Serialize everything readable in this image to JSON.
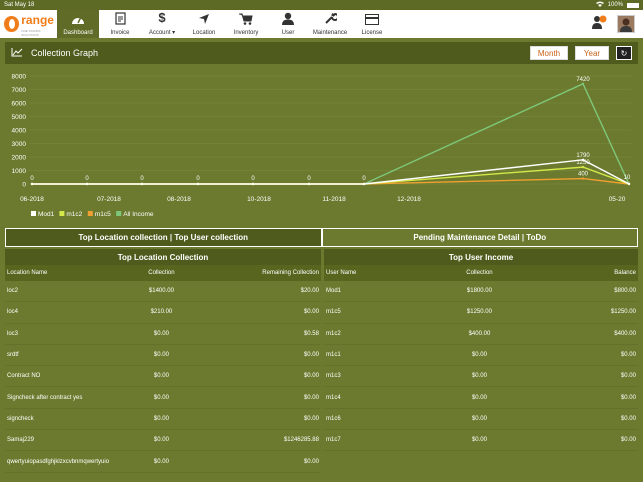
{
  "status": {
    "time_date": "Sat May 18",
    "battery": "100%"
  },
  "app": {
    "logo_text": "range",
    "logo_tag": "ONE STANDS SOLUTIONS"
  },
  "nav": [
    {
      "label": "Dashboard",
      "icon": "dashboard-icon",
      "active": true
    },
    {
      "label": "Invoice",
      "icon": "invoice-icon"
    },
    {
      "label": "Account ▾",
      "icon": "dollar-icon"
    },
    {
      "label": "Location",
      "icon": "location-arrow-icon"
    },
    {
      "label": "Inventory",
      "icon": "cart-icon"
    },
    {
      "label": "User",
      "icon": "user-icon"
    },
    {
      "label": "Maintenance",
      "icon": "wrench-icon"
    },
    {
      "label": "License",
      "icon": "license-card-icon"
    }
  ],
  "chart_header": {
    "title": "Collection Graph",
    "month_label": "Month",
    "year_label": "Year",
    "refresh_symbol": "↻"
  },
  "chart_data": {
    "type": "line",
    "x": [
      "06-2018",
      "07-2018",
      "08-2018",
      "10-2018",
      "11-2018",
      "12-2018",
      "05-20"
    ],
    "ylim": [
      0,
      8000
    ],
    "yticks": [
      0,
      1000,
      2000,
      3000,
      4000,
      5000,
      6000,
      7000,
      8000
    ],
    "point_labels": [
      {
        "x": "06-2018",
        "text": "0"
      },
      {
        "x": "07-2018",
        "text": "0"
      },
      {
        "x": "08-2018",
        "text": "0"
      },
      {
        "x": "10-2018",
        "text": "0"
      },
      {
        "x": "11-2018",
        "text": "0"
      },
      {
        "x": "12-2018",
        "text": "0"
      },
      {
        "x": "12-2018b",
        "text": "0"
      },
      {
        "x": "05-20",
        "text": "10"
      }
    ],
    "series": [
      {
        "name": "Mod1",
        "color": "#ffffff",
        "values": [
          0,
          0,
          0,
          0,
          0,
          0,
          0,
          1790,
          10
        ]
      },
      {
        "name": "m1c2",
        "color": "#d4e84a",
        "values": [
          0,
          0,
          0,
          0,
          0,
          0,
          0,
          1250,
          0
        ]
      },
      {
        "name": "m1c5",
        "color": "#f0a030",
        "values": [
          0,
          0,
          0,
          0,
          0,
          0,
          0,
          400,
          0
        ]
      },
      {
        "name": "All Income",
        "color": "#7fc77a",
        "values": [
          0,
          0,
          0,
          0,
          0,
          0,
          0,
          7420,
          0
        ]
      }
    ],
    "peak_labels": [
      "7420",
      "1790",
      "1250",
      "400"
    ],
    "legend_position": "bottom-left"
  },
  "tabs": {
    "left": "Top Location collection | Top User collection",
    "right": "Pending Maintenance Detail | ToDo"
  },
  "location_table": {
    "title": "Top Location Collection",
    "headers": [
      "Location Name",
      "Collection",
      "Remaining Collection"
    ],
    "rows": [
      [
        "loc2",
        "$1400.00",
        "$20.00"
      ],
      [
        "loc4",
        "$210.00",
        "$0.00"
      ],
      [
        "loc3",
        "$0.00",
        "$0.58"
      ],
      [
        "srdtf",
        "$0.00",
        "$0.00"
      ],
      [
        "Contract NO",
        "$0.00",
        "$0.00"
      ],
      [
        "Signcheck after contract yes",
        "$0.00",
        "$0.00"
      ],
      [
        "signcheck",
        "$0.00",
        "$0.00"
      ],
      [
        "Samaj229",
        "$0.00",
        "$1246285.88"
      ],
      [
        "qwertyuiopasdfghjklzxcvbnmqwertyuio",
        "$0.00",
        "$0.00"
      ]
    ]
  },
  "user_table": {
    "title": "Top User Income",
    "headers": [
      "User Name",
      "Collection",
      "Balance"
    ],
    "rows": [
      [
        "Mod1",
        "$1800.00",
        "$800.00"
      ],
      [
        "m1c5",
        "$1250.00",
        "$1250.00"
      ],
      [
        "m1c2",
        "$400.00",
        "$400.00"
      ],
      [
        "m1c1",
        "$0.00",
        "$0.00"
      ],
      [
        "m1c3",
        "$0.00",
        "$0.00"
      ],
      [
        "m1c4",
        "$0.00",
        "$0.00"
      ],
      [
        "m1c6",
        "$0.00",
        "$0.00"
      ],
      [
        "m1c7",
        "$0.00",
        "$0.00"
      ]
    ]
  }
}
